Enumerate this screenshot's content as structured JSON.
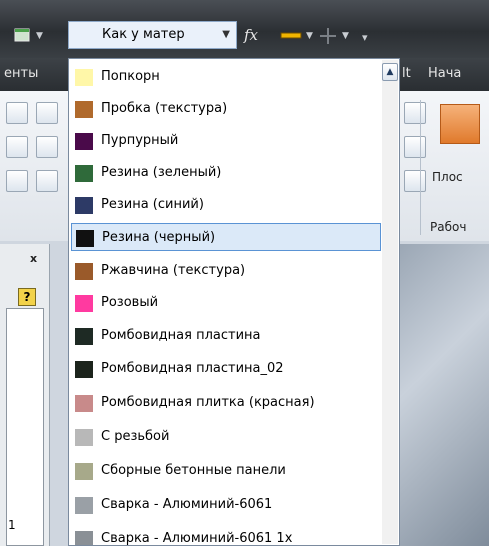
{
  "toolbar": {
    "material_value": "Как у матер",
    "fx_label": "fx"
  },
  "ribbon": {
    "tab_left": "енты",
    "tab_it": "lt",
    "tab_start": "Нача",
    "plos_label": "Плос",
    "work_label": "Рабоч"
  },
  "panel": {
    "close_label": "x",
    "help_label": "?",
    "digit": "1"
  },
  "materials": [
    {
      "label": "Попкорн",
      "color": "#fff7a8"
    },
    {
      "label": "Пробка (текстура)",
      "color": "#b06a2c"
    },
    {
      "label": "Пурпурный",
      "color": "#4a0a4a"
    },
    {
      "label": "Резина (зеленый)",
      "color": "#2f6a3a"
    },
    {
      "label": "Резина (синий)",
      "color": "#2d3a66"
    },
    {
      "label": "Резина (черный)",
      "color": "#111111",
      "selected": true
    },
    {
      "label": "Ржавчина (текстура)",
      "color": "#9a5a2a"
    },
    {
      "label": "Розовый",
      "color": "#ff3aa0"
    },
    {
      "label": "Ромбовидная пластина",
      "color": "#1e2a24"
    },
    {
      "label": "Ромбовидная пластина_02",
      "color": "#1c241c"
    },
    {
      "label": "Ромбовидная плитка (красная)",
      "color": "#c88a8a"
    },
    {
      "label": "С резьбой",
      "color": "#b8b8b8"
    },
    {
      "label": "Сборные бетонные панели",
      "color": "#a7a98a"
    },
    {
      "label": "Сварка - Алюминий-6061",
      "color": "#9aa0a6"
    },
    {
      "label": "Сварка - Алюминий-6061 1х",
      "color": "#8a9096"
    }
  ]
}
